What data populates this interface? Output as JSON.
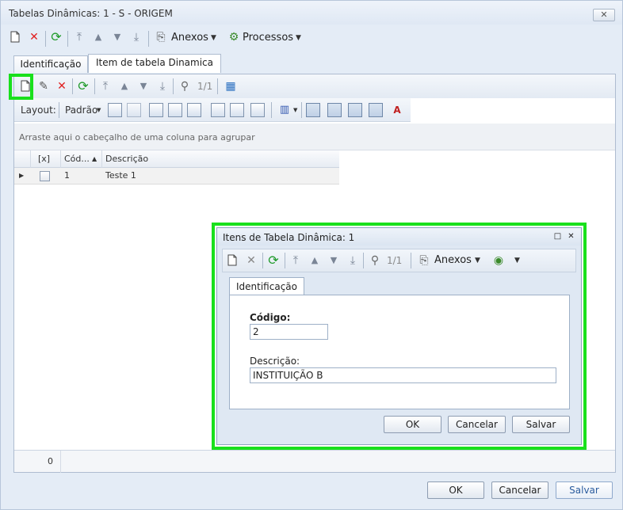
{
  "window": {
    "title": "Tabelas Dinâmicas: 1 - S - ORIGEM",
    "close_label": "✕"
  },
  "main_toolbar": {
    "page_indicator": "",
    "attachments_label": "Anexos",
    "processes_label": "Processos"
  },
  "tabs": [
    {
      "label": "Identificação"
    },
    {
      "label": "Item de tabela Dinamica"
    }
  ],
  "inner_toolbar": {
    "page_indicator": "1/1"
  },
  "layout_bar": {
    "layout_label": "Layout:",
    "default_label": "Padrão"
  },
  "group_area": {
    "hint": "Arraste aqui o cabeçalho de uma coluna para agrupar"
  },
  "grid": {
    "headers": {
      "check": "[x]",
      "code": "Cód...",
      "description": "Descrição"
    },
    "rows": [
      {
        "code": "1",
        "description": "Teste 1"
      }
    ],
    "footer_count": "0"
  },
  "main_buttons": {
    "ok": "OK",
    "cancel": "Cancelar",
    "save": "Salvar"
  },
  "dialog": {
    "title": "Itens de Tabela Dinâmica: 1",
    "page_indicator": "1/1",
    "attachments_label": "Anexos",
    "tab_label": "Identificação",
    "code_label": "Código:",
    "code_value": "2",
    "description_label": "Descrição:",
    "description_value": "INSTITUIÇÃO B",
    "ok": "OK",
    "cancel": "Cancelar",
    "save": "Salvar"
  },
  "colors": {
    "highlight": "#19e01c",
    "save_text": "#2b5c9e",
    "delete_red": "#e02020",
    "refresh_green": "#1f9a2a"
  }
}
